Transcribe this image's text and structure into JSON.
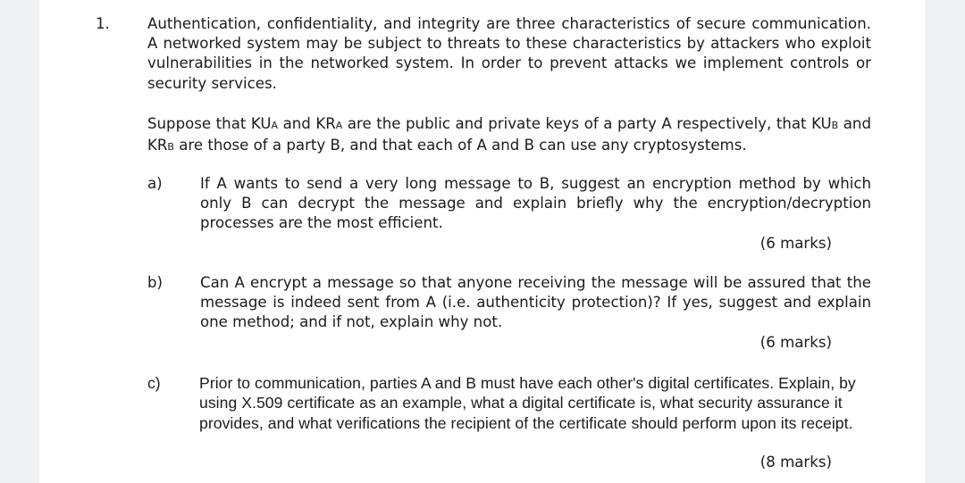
{
  "question": {
    "number": "1.",
    "intro": "Authentication, confidentiality, and integrity are three characteristics of secure communication. A networked system may be subject to threats to these characteristics by attackers who exploit vulnerabilities in the networked system. In order to prevent attacks we implement controls or security services.",
    "keys": {
      "p1": "Suppose that ",
      "ku_a": "KU",
      "ku_a_sub": "A",
      "p2": " and ",
      "kr_a": "KR",
      "kr_a_sub": "A",
      "p3": " are the public and private keys of a party A respectively, that ",
      "ku_b": "KU",
      "ku_b_sub": "B",
      "p4": " and ",
      "kr_b": "KR",
      "kr_b_sub": "B",
      "p5": " are those of a party B, and that each of A and B can use any cryptosystems."
    },
    "parts": [
      {
        "label": "a)",
        "text": "If A wants to send a very long message to B, suggest an encryption method by which only B can decrypt the message and explain briefly why the encryption/decryption processes are the most efficient.",
        "marks": "(6 marks)"
      },
      {
        "label": "b)",
        "text": "Can A encrypt a message so that anyone receiving the message will be assured that the message is indeed sent from A (i.e. authenticity protection)? If yes, suggest and explain one method; and if not, explain why not.",
        "marks": "(6 marks)"
      },
      {
        "label": "c)",
        "text": "Prior to communication, parties A and B must have each other's digital certificates. Explain, by using X.509 certificate as an example, what a digital certificate is, what security assurance it provides, and what verifications the recipient of the certificate should perform upon its receipt.",
        "marks": "(8 marks)"
      }
    ]
  }
}
